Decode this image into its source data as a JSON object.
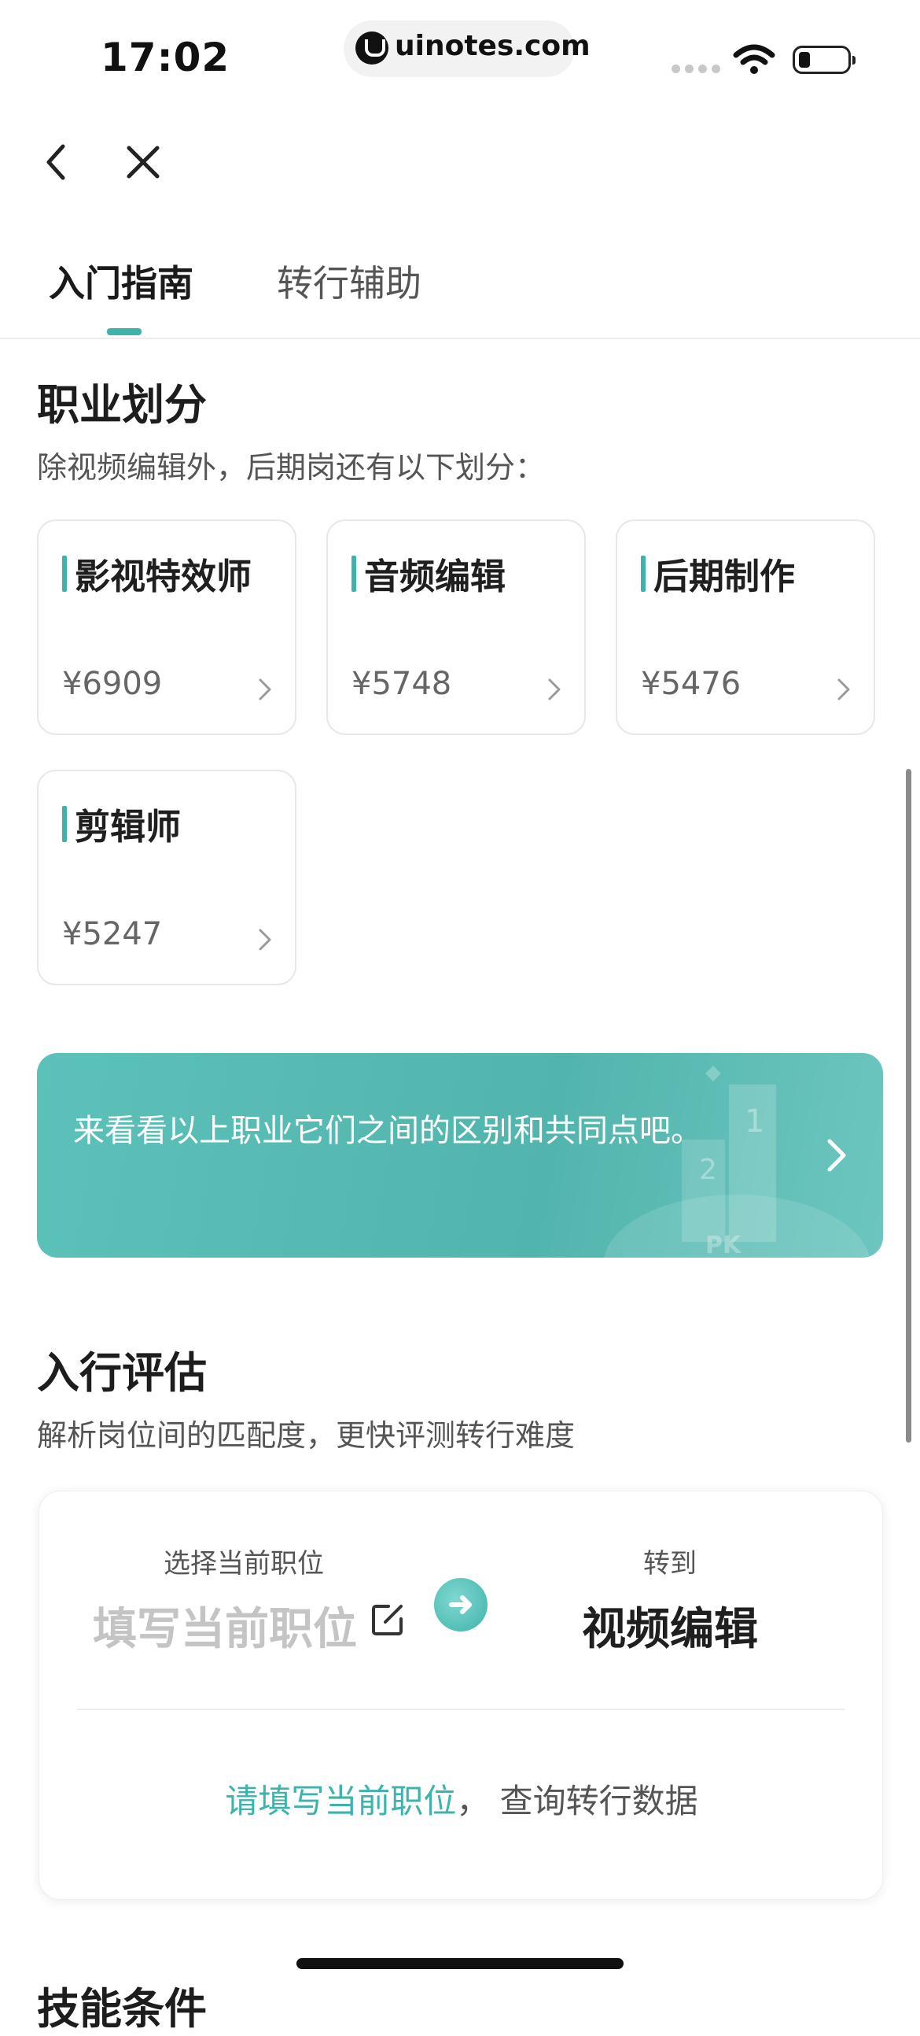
{
  "status_bar": {
    "time": "17:02",
    "url": "uinotes.com"
  },
  "nav": {
    "back_icon": "chevron-left-icon",
    "close_icon": "close-icon"
  },
  "tabs": [
    {
      "label": "入门指南",
      "active": true
    },
    {
      "label": "转行辅助",
      "active": false
    }
  ],
  "career": {
    "title": "职业划分",
    "subtitle": "除视频编辑外，后期岗还有以下划分：",
    "cards": [
      {
        "title": "影视特效师",
        "salary": "¥6909"
      },
      {
        "title": "音频编辑",
        "salary": "¥5748"
      },
      {
        "title": "后期制作",
        "salary": "¥5476"
      },
      {
        "title": "剪辑师",
        "salary": "¥5247"
      }
    ]
  },
  "banner": {
    "text": "来看看以上职业它们之间的区别和共同点吧。",
    "deco_labels": [
      "1",
      "2",
      "PK"
    ]
  },
  "assessment": {
    "title": "入行评估",
    "subtitle": "解析岗位间的匹配度，更快评测转行难度",
    "current_label": "选择当前职位",
    "current_placeholder": "填写当前职位",
    "target_label": "转到",
    "target_value": "视频编辑",
    "bottom_link": "请填写当前职位",
    "bottom_rest": "，  查询转行数据"
  },
  "next_section": {
    "title_partial": "技能条件"
  },
  "colors": {
    "accent": "#3db3ac",
    "banner": "#56b8b0"
  }
}
